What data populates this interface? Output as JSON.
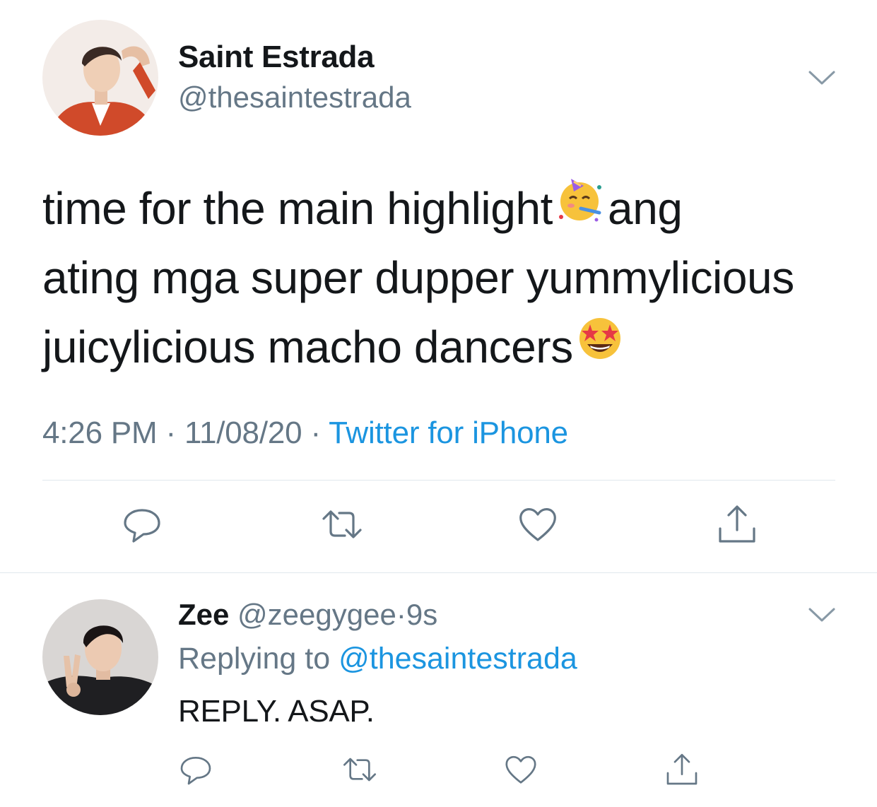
{
  "tweet": {
    "author_name": "Saint Estrada",
    "author_handle": "@thesaintestrada",
    "text_line1": "time for the main highlight",
    "text_line1b": "ang",
    "text_line2": "ating mga super dupper yummylicious",
    "text_line3": "juicylicious macho dancers",
    "time": "4:26 PM",
    "date": "11/08/20",
    "separator": "·",
    "source": "Twitter for iPhone",
    "emoji_1": "partying-face-emoji",
    "emoji_2": "star-struck-emoji"
  },
  "reply": {
    "author_name": "Zee",
    "author_handle": "@zeegygee",
    "separator": "·",
    "time_ago": "9s",
    "replying_prefix": "Replying to",
    "replying_to": "@thesaintestrada",
    "text": "REPLY. ASAP."
  },
  "icons": {
    "reply": "reply-icon",
    "retweet": "retweet-icon",
    "like": "heart-icon",
    "share": "share-icon",
    "more": "chevron-down-icon"
  },
  "colors": {
    "text": "#14171a",
    "secondary": "#657786",
    "link": "#1b95e0",
    "divider": "#e1e8ed"
  }
}
